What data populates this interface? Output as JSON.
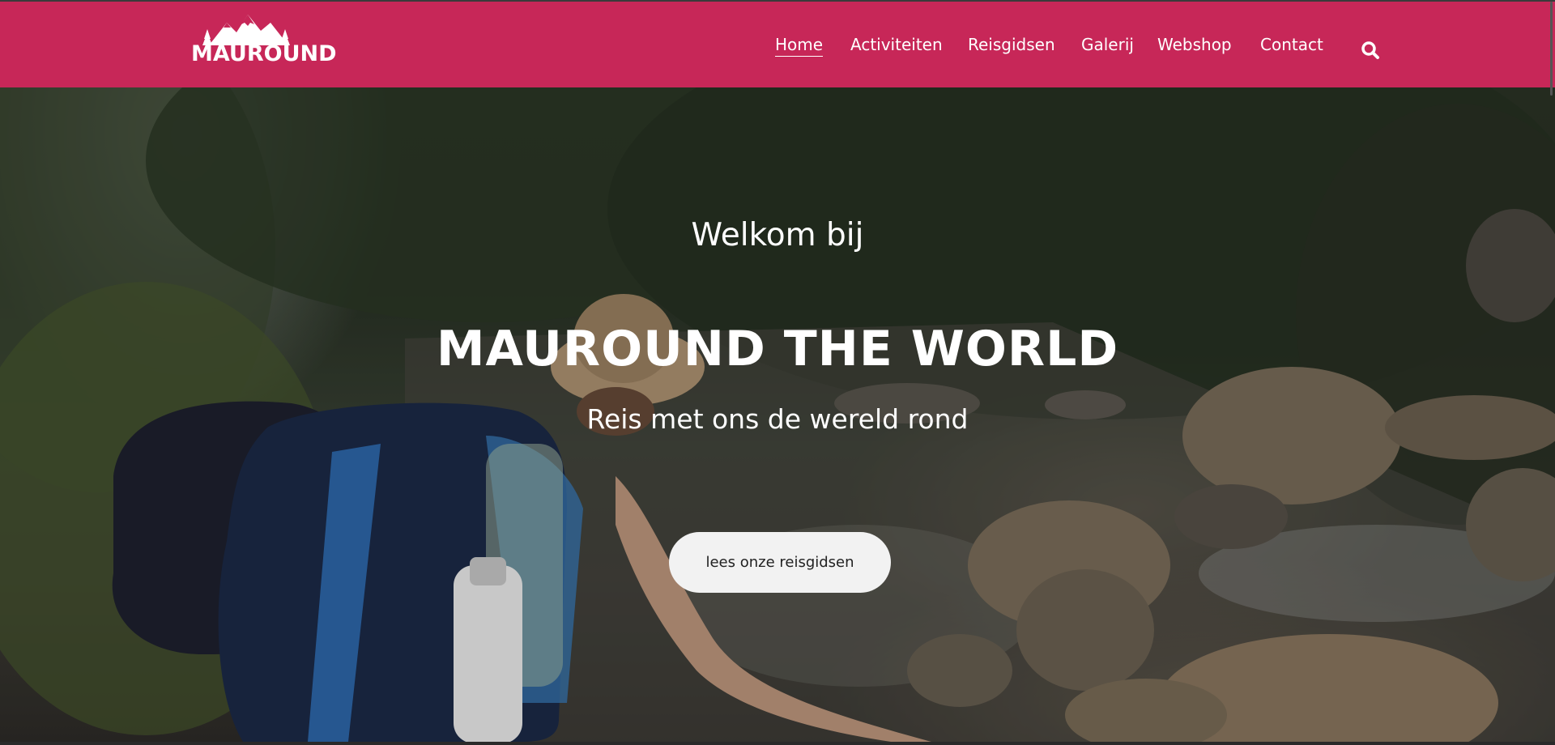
{
  "brand": {
    "logo_text": "MAUROUND",
    "logo_icon": "mountain-pine-logo"
  },
  "nav": {
    "items": [
      {
        "label": "Home",
        "active": true
      },
      {
        "label": "Activiteiten",
        "active": false
      },
      {
        "label": "Reisgidsen",
        "active": false
      },
      {
        "label": "Galerij",
        "active": false
      },
      {
        "label": "Webshop",
        "active": false
      },
      {
        "label": "Contact",
        "active": false
      }
    ],
    "search_icon": "search-icon"
  },
  "hero": {
    "welcome": "Welkom bij",
    "headline": "MAUROUND THE WORLD",
    "subline": "Reis met ons de wereld rond",
    "cta_label": "lees onze reisgidsen",
    "background": "hiker-with-backpack-crossing-river-photo"
  },
  "colors": {
    "header_bg": "#c72758",
    "cta_bg": "#f2f2f2",
    "text": "#ffffff"
  }
}
